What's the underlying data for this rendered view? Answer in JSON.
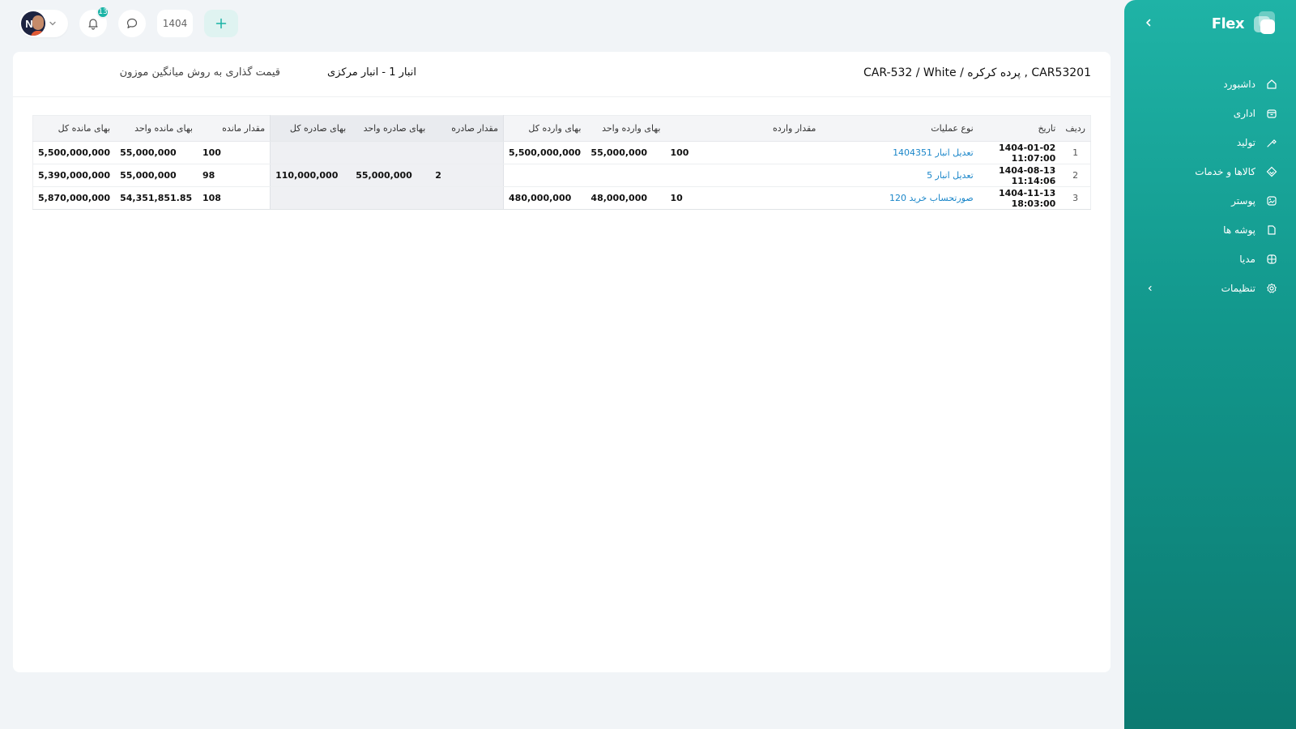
{
  "sidebar": {
    "logo_text": "Flex",
    "items": [
      {
        "label": "داشبورد",
        "icon": "home-icon"
      },
      {
        "label": "اداری",
        "icon": "archive-box-icon"
      },
      {
        "label": "تولید",
        "icon": "tools-icon"
      },
      {
        "label": "کالاها و خدمات",
        "icon": "layers-icon"
      },
      {
        "label": "پوستر",
        "icon": "image-icon"
      },
      {
        "label": "پوشه ها",
        "icon": "folder-icon"
      },
      {
        "label": "مدیا",
        "icon": "globe-icon"
      },
      {
        "label": "تنظیمات",
        "icon": "gear-icon"
      }
    ]
  },
  "topbar": {
    "notification_count": "13",
    "year": "1404"
  },
  "header": {
    "product": "CAR53201 , پرده کرکره / CAR-532 / White",
    "warehouse": "انبار 1 - انبار مرکزی",
    "pricing": "قیمت گذاری به روش میانگین موزون"
  },
  "table": {
    "columns": [
      "ردیف",
      "تاریخ",
      "نوع عملیات",
      "مقدار وارده",
      "بهای وارده واحد",
      "بهای وارده کل",
      "مقدار صادره",
      "بهای صادره واحد",
      "بهای صادره کل",
      "مقدار مانده",
      "بهای مانده واحد",
      "بهای مانده کل"
    ],
    "rows": [
      {
        "idx": "1",
        "date": "1404-01-02 11:07:00",
        "op": "تعدیل انبار 1404351",
        "in_qty": "100",
        "in_unit": "55,000,000",
        "in_total": "5,500,000,000",
        "out_qty": "",
        "out_unit": "",
        "out_total": "",
        "rem_qty": "100",
        "rem_unit": "55,000,000",
        "rem_total": "5,500,000,000"
      },
      {
        "idx": "2",
        "date": "1404-08-13 11:14:06",
        "op": "تعدیل انبار 5",
        "in_qty": "",
        "in_unit": "",
        "in_total": "",
        "out_qty": "2",
        "out_unit": "55,000,000",
        "out_total": "110,000,000",
        "rem_qty": "98",
        "rem_unit": "55,000,000",
        "rem_total": "5,390,000,000"
      },
      {
        "idx": "3",
        "date": "1404-11-13 18:03:00",
        "op": "صورتحساب خرید 120",
        "in_qty": "10",
        "in_unit": "48,000,000",
        "in_total": "480,000,000",
        "out_qty": "",
        "out_unit": "",
        "out_total": "",
        "rem_qty": "108",
        "rem_unit": "54,351,851.85",
        "rem_total": "5,870,000,000"
      }
    ]
  },
  "colors": {
    "accent": "#19b3a5",
    "link": "#1a86c9"
  }
}
